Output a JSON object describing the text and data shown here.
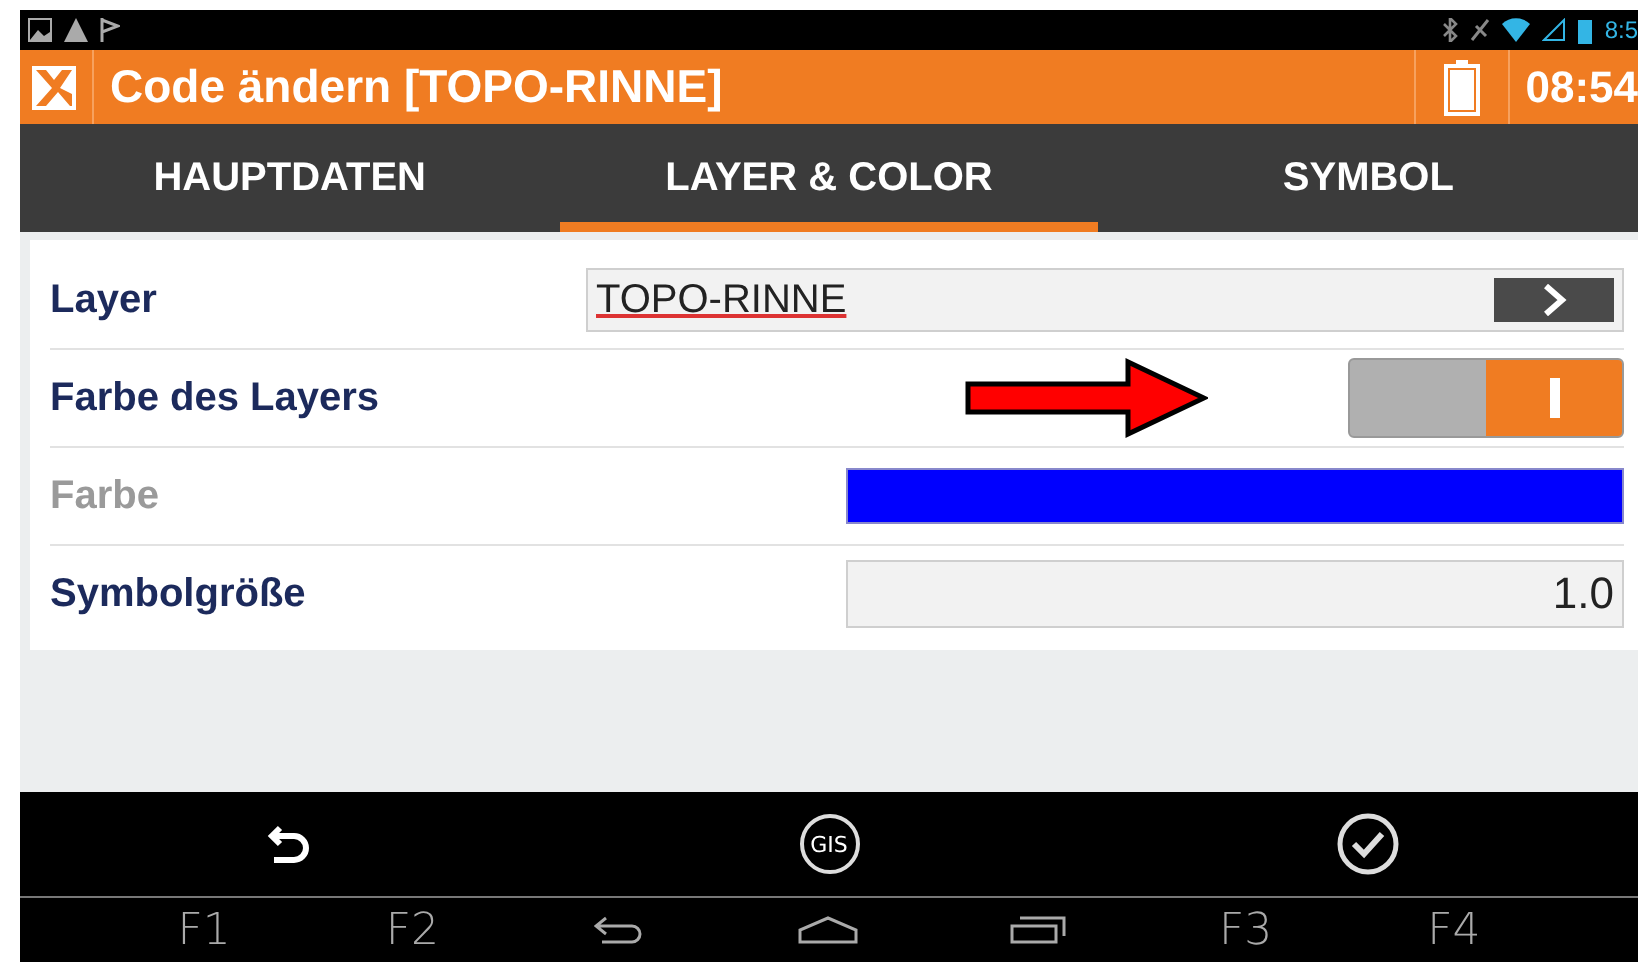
{
  "status_bar": {
    "time": "8:5"
  },
  "header": {
    "title": "Code ändern [TOPO-RINNE]",
    "time": "08:54"
  },
  "tabs": [
    {
      "label": "HAUPTDATEN",
      "selected": false
    },
    {
      "label": "LAYER & COLOR",
      "selected": true
    },
    {
      "label": "SYMBOL",
      "selected": false
    }
  ],
  "fields": [
    {
      "kind": "select",
      "label": "Layer",
      "value": "TOPO-RINNE",
      "disabled": false
    },
    {
      "kind": "toggle",
      "label": "Farbe des Layers",
      "on": true,
      "disabled": false
    },
    {
      "kind": "color",
      "label": "Farbe",
      "color": "#0000ff",
      "disabled": true
    },
    {
      "kind": "number",
      "label": "Symbolgröße",
      "value": "1.0",
      "disabled": false
    }
  ],
  "action_bar": [
    {
      "kind": "undo"
    },
    {
      "kind": "gis",
      "label": "GIS"
    },
    {
      "kind": "confirm"
    }
  ],
  "nav_bar": [
    {
      "kind": "key",
      "label": "F1"
    },
    {
      "kind": "key",
      "label": "F2"
    },
    {
      "kind": "back"
    },
    {
      "kind": "home"
    },
    {
      "kind": "recent"
    },
    {
      "kind": "key",
      "label": "F3"
    },
    {
      "kind": "key",
      "label": "F4"
    }
  ]
}
